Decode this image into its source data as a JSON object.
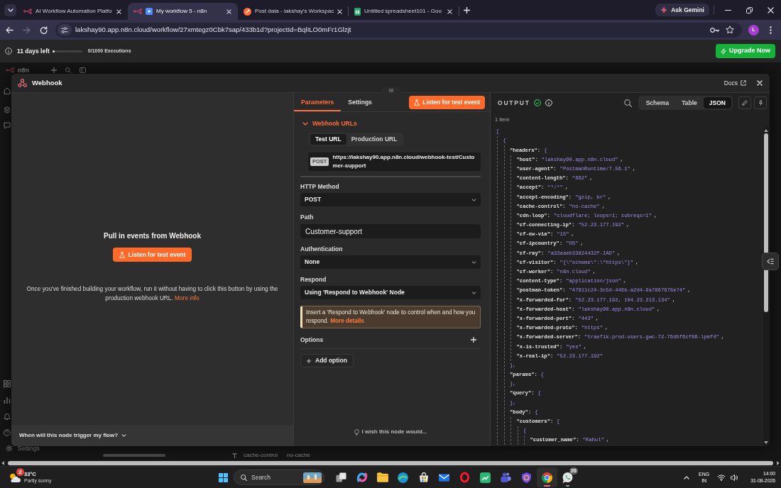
{
  "browser": {
    "tabs": [
      {
        "kind": "workflow",
        "title": "AI Workflow Automation Platfo",
        "selected": false
      },
      {
        "kind": "workflow-play",
        "title": "My workflow 5 - n8n",
        "selected": true
      },
      {
        "kind": "circle-logo",
        "title": "Post data - lakshay's Workspac",
        "selected": false
      },
      {
        "kind": "sheet",
        "title": "Untitled spreadsheet101 - Goo",
        "selected": false
      }
    ],
    "gemini_button": "Ask Gemini",
    "forward_disabled": true,
    "url": "lakshay90.app.n8n.cloud/workflow/27xmtegz0Cbk7sap/433b1d?projectId=BqlILO0mFr1Glzjt",
    "profile_initial": "L"
  },
  "banner": {
    "trial": "11 days left",
    "level": 0.05,
    "executions": "0/1000 Executions",
    "upgrade_button": "Upgrade Now"
  },
  "background": {
    "logo_text": "n8n",
    "sidebar_item": "Settings",
    "canvas_texts": [
      "cache-control",
      "no-cache"
    ]
  },
  "modal": {
    "title": "Webhook",
    "docs_link": "Docs",
    "input_panel": {
      "heading": "Pull in events from Webhook",
      "listen_button": "Listen for test event",
      "note": "Once you've finished building your workflow, run it without having to click this button by using the production webhook URL.",
      "note_link": "More info",
      "footer": "When will this node trigger my flow?"
    },
    "parameters_panel": {
      "tabs": [
        {
          "label": "Parameters",
          "selected": true
        },
        {
          "label": "Settings",
          "selected": false
        }
      ],
      "listen_button": "Listen for test event",
      "section": {
        "title": "Webhook URLs",
        "expanded": true
      },
      "url_tabs": [
        {
          "label": "Test URL",
          "selected": true
        },
        {
          "label": "Production URL",
          "selected": false
        }
      ],
      "method_badge": "POST",
      "webhook_url": "https://lakshay90.app.n8n.cloud/webhook-test/Customer-support",
      "fields": [
        {
          "kind": "select",
          "label": "HTTP Method",
          "value": "POST"
        },
        {
          "kind": "input",
          "label": "Path",
          "value": "Customer-support"
        },
        {
          "kind": "select",
          "label": "Authentication",
          "value": "None"
        },
        {
          "kind": "select",
          "label": "Respond",
          "value": "Using 'Respond to Webhook' Node"
        }
      ],
      "notice": {
        "text": "Insert a 'Respond to Webhook' node to control when and how you respond.",
        "link": "More details"
      },
      "options_label": "Options",
      "add_option_button": "Add option",
      "feedback": "I wish this node would..."
    },
    "output_panel": {
      "title": "OUTPUT",
      "success": true,
      "views": [
        {
          "label": "Schema",
          "selected": false
        },
        {
          "label": "Table",
          "selected": false
        },
        {
          "label": "JSON",
          "selected": true
        }
      ],
      "item_count": "1 item",
      "json_tree": {
        "open": "[",
        "children": [
          {
            "open": "{",
            "children": [
              {
                "key": "\"headers\":",
                "open": "{",
                "children": [
                  {
                    "key": "\"host\":",
                    "value": "\"lakshay90.app.n8n.cloud\"",
                    "punct": ","
                  },
                  {
                    "key": "\"user-agent\":",
                    "value": "\"PostmanRuntime/7.56.1\"",
                    "punct": ","
                  },
                  {
                    "key": "\"content-length\":",
                    "value": "\"662\"",
                    "punct": ","
                  },
                  {
                    "key": "\"accept\":",
                    "value": "\"*/*\"",
                    "punct": ","
                  },
                  {
                    "key": "\"accept-encoding\":",
                    "value": "\"gzip, br\"",
                    "punct": ","
                  },
                  {
                    "key": "\"cache-control\":",
                    "value": "\"no-cache\"",
                    "punct": ","
                  },
                  {
                    "key": "\"cdn-loop\":",
                    "value": "\"cloudflare; loops=1; subreqs=1\"",
                    "punct": ","
                  },
                  {
                    "key": "\"cf-connecting-ip\":",
                    "value": "\"52.23.177.192\"",
                    "punct": ","
                  },
                  {
                    "key": "\"cf-ew-via\":",
                    "value": "\"15\"",
                    "punct": ","
                  },
                  {
                    "key": "\"cf-ipcountry\":",
                    "value": "\"US\"",
                    "punct": ","
                  },
                  {
                    "key": "\"cf-ray\":",
                    "value": "\"a33aaeb33824432f-IAD\"",
                    "punct": ","
                  },
                  {
                    "key": "\"cf-visitor\":",
                    "value": "\"{\\\"scheme\\\":\\\"https\\\"}\"",
                    "punct": ","
                  },
                  {
                    "key": "\"cf-worker\":",
                    "value": "\"n8n.cloud\"",
                    "punct": ","
                  },
                  {
                    "key": "\"content-type\":",
                    "value": "\"application/json\"",
                    "punct": ","
                  },
                  {
                    "key": "\"postman-token\":",
                    "value": "\"47811c24-3c5d-446b-a2d4-9a7867678e74\"",
                    "punct": ","
                  },
                  {
                    "key": "\"x-forwarded-for\":",
                    "value": "\"52.23.177.192, 104.23.213.134\"",
                    "punct": ","
                  },
                  {
                    "key": "\"x-forwarded-host\":",
                    "value": "\"lakshay90.app.n8n.cloud\"",
                    "punct": ","
                  },
                  {
                    "key": "\"x-forwarded-port\":",
                    "value": "\"443\"",
                    "punct": ","
                  },
                  {
                    "key": "\"x-forwarded-proto\":",
                    "value": "\"https\"",
                    "punct": ","
                  },
                  {
                    "key": "\"x-forwarded-server\":",
                    "value": "\"traefik-prod-users-gwc-72-76dbf6cf96-lpmf4\"",
                    "punct": ","
                  },
                  {
                    "key": "\"x-is-trusted\":",
                    "value": "\"yes\"",
                    "punct": ","
                  },
                  {
                    "key": "\"x-real-ip\":",
                    "value": "\"52.23.177.192\""
                  }
                ],
                "close": "},"
              },
              {
                "key": "\"params\":",
                "open": "{",
                "close": "},"
              },
              {
                "key": "\"query\":",
                "open": "{",
                "close": "},"
              },
              {
                "key": "\"body\":",
                "open": "{",
                "children": [
                  {
                    "key": "\"customers\":",
                    "open": "[",
                    "children": [
                      {
                        "open": "{",
                        "children": [
                          {
                            "key": "\"customer_name\":",
                            "value": "\"Rahul\"",
                            "punct": ","
                          }
                        ]
                      }
                    ]
                  }
                ]
              }
            ]
          }
        ]
      }
    }
  },
  "taskbar": {
    "weather": {
      "badge": "2",
      "temperature": "33°C",
      "condition": "Partly sunny"
    },
    "search_placeholder": "Search",
    "apps": [
      {
        "kind": "task-view",
        "selected": false,
        "open": false
      },
      {
        "kind": "swirl",
        "selected": false,
        "open": false
      },
      {
        "kind": "folder",
        "selected": false,
        "open": false
      },
      {
        "kind": "wave",
        "selected": false,
        "open": false
      },
      {
        "kind": "store",
        "selected": false,
        "open": false
      },
      {
        "kind": "mail",
        "selected": false,
        "open": false
      },
      {
        "kind": "ring",
        "selected": false,
        "open": false
      },
      {
        "kind": "chart",
        "selected": false,
        "open": false
      },
      {
        "kind": "people",
        "selected": false,
        "open": false
      },
      {
        "kind": "shield",
        "selected": false,
        "open": false
      },
      {
        "kind": "browser",
        "selected": true,
        "open": true
      },
      {
        "kind": "chat",
        "selected": false,
        "open": true,
        "badge": "20"
      }
    ],
    "language": [
      "ENG",
      "IN"
    ],
    "time": "14:00",
    "date": "31-08-2026"
  }
}
